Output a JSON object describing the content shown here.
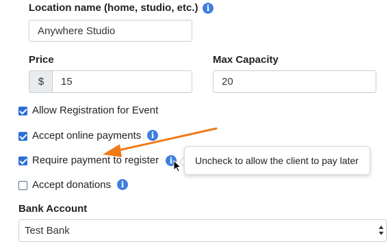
{
  "location": {
    "label": "Location name (home, studio, etc.)",
    "value": "Anywhere Studio",
    "info_icon": "info-icon"
  },
  "price": {
    "label": "Price",
    "currency_symbol": "$",
    "value": "15"
  },
  "capacity": {
    "label": "Max Capacity",
    "value": "20"
  },
  "options": [
    {
      "label": "Allow Registration for Event",
      "checked": true
    },
    {
      "label": "Accept online payments",
      "checked": true
    },
    {
      "label": "Require payment to register",
      "checked": true
    },
    {
      "label": "Accept donations",
      "checked": false
    }
  ],
  "tooltip": {
    "text": "Uncheck to allow the client to pay later"
  },
  "bank_account": {
    "label": "Bank Account",
    "selected": "Test Bank"
  },
  "colors": {
    "accent": "#2c6fd6",
    "info_icon": "#3d7fe0",
    "annotation_arrow": "#f07a1a"
  }
}
